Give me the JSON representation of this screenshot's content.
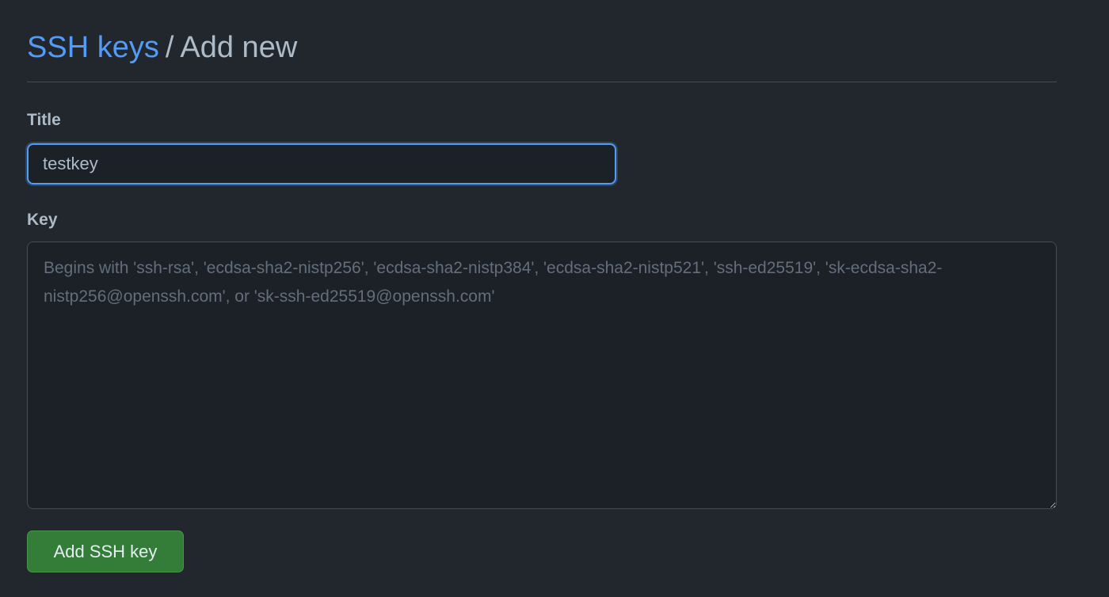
{
  "header": {
    "breadcrumb_link": "SSH keys",
    "separator": "/",
    "current": "Add new"
  },
  "form": {
    "title_label": "Title",
    "title_value": "testkey",
    "key_label": "Key",
    "key_placeholder": "Begins with 'ssh-rsa', 'ecdsa-sha2-nistp256', 'ecdsa-sha2-nistp384', 'ecdsa-sha2-nistp521', 'ssh-ed25519', 'sk-ecdsa-sha2-nistp256@openssh.com', or 'sk-ssh-ed25519@openssh.com'",
    "key_value": "",
    "submit_label": "Add SSH key"
  },
  "colors": {
    "background": "#22272e",
    "link": "#539bf5",
    "focus_border": "#539bf5",
    "button_green": "#347d39"
  }
}
